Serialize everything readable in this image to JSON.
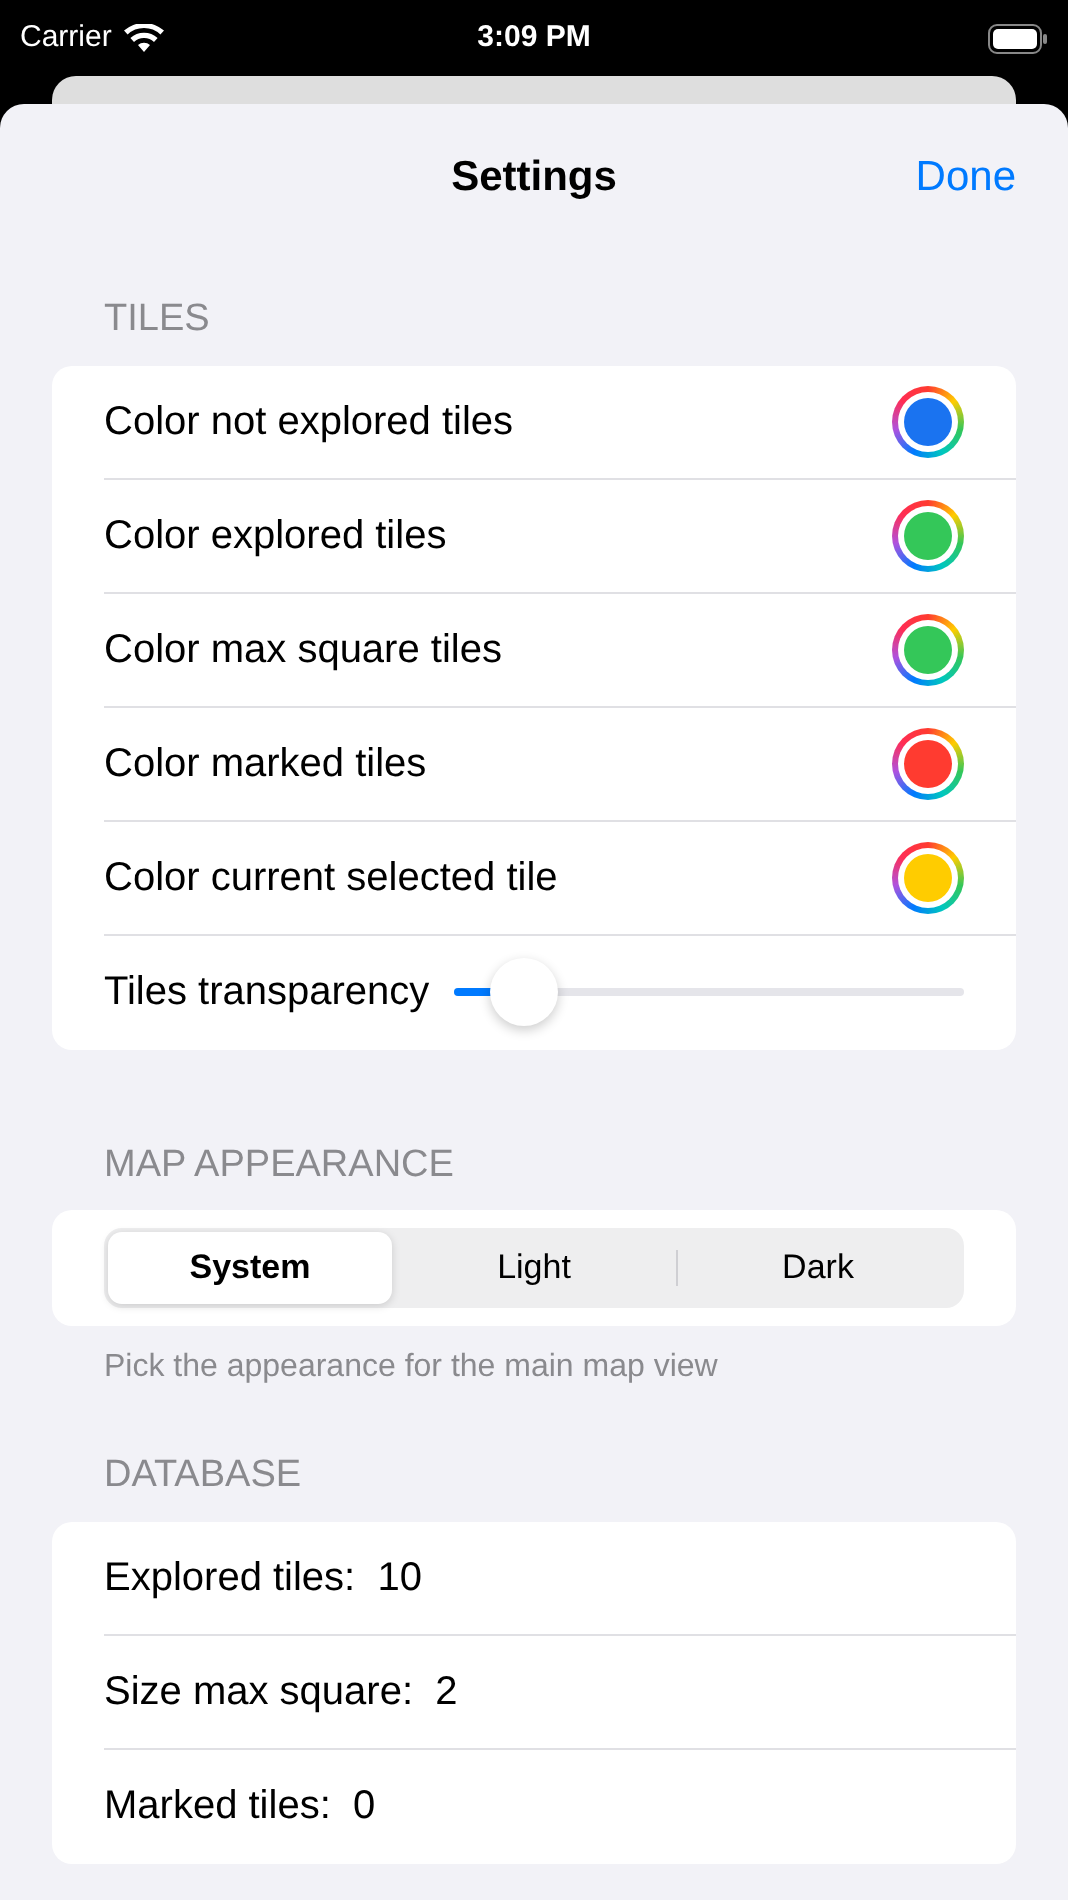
{
  "status_bar": {
    "carrier": "Carrier",
    "time": "3:09 PM"
  },
  "nav": {
    "title": "Settings",
    "done": "Done"
  },
  "tiles": {
    "header": "TILES",
    "rows": [
      {
        "kind": "color",
        "label": "Color not explored tiles",
        "color": "#1a73f0"
      },
      {
        "kind": "color",
        "label": "Color explored tiles",
        "color": "#34c759"
      },
      {
        "kind": "color",
        "label": "Color max square tiles",
        "color": "#34c759"
      },
      {
        "kind": "color",
        "label": "Color marked tiles",
        "color": "#ff3b30"
      },
      {
        "kind": "color",
        "label": "Color current selected tile",
        "color": "#ffcc00"
      },
      {
        "kind": "slider",
        "label": "Tiles transparency",
        "level": 0.14
      }
    ]
  },
  "map_appearance": {
    "header": "MAP APPEARANCE",
    "segments": [
      {
        "label": "System",
        "selected": true
      },
      {
        "label": "Light",
        "selected": false
      },
      {
        "label": "Dark",
        "selected": false
      }
    ],
    "footer": "Pick the appearance for the main map view"
  },
  "database": {
    "header": "DATABASE",
    "rows": [
      {
        "label": "Explored tiles:  10"
      },
      {
        "label": "Size max square:  2"
      },
      {
        "label": "Marked tiles:  0"
      }
    ]
  }
}
